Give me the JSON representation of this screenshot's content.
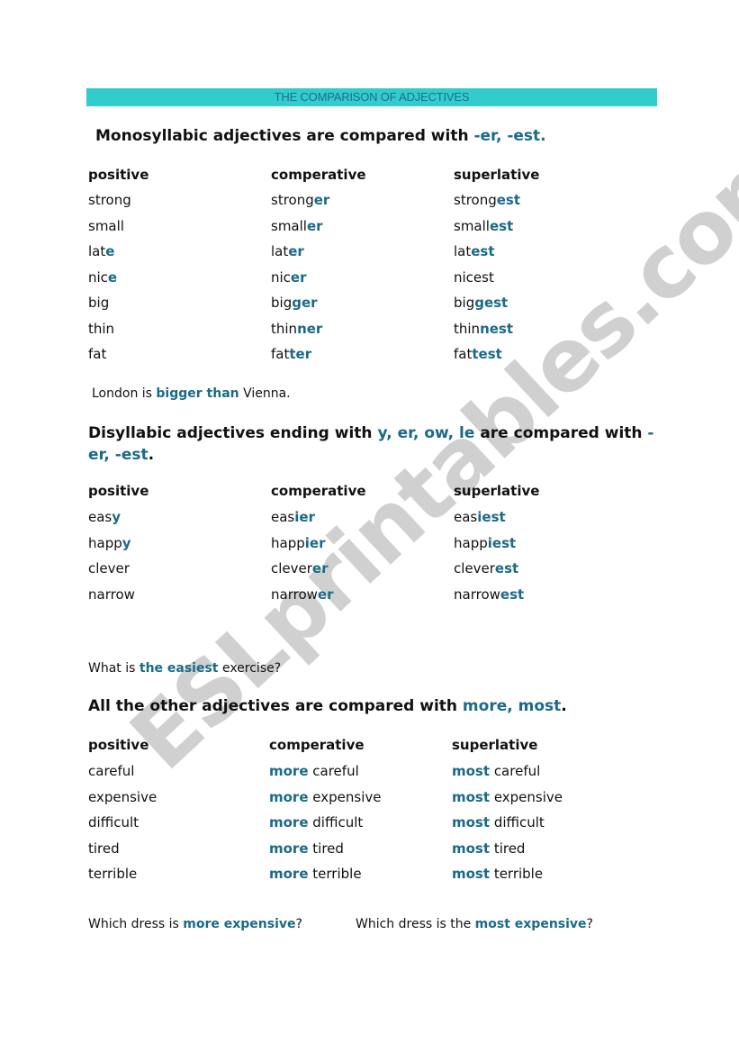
{
  "title": "THE COMPARISON OF ADJECTIVES",
  "colors": {
    "title_bar": "#33cccc",
    "accent": "#1b6a86",
    "watermark": "#999999"
  },
  "watermark": "ESLprintables.com",
  "columns": {
    "positive": "positive",
    "comparative": "comperative",
    "superlative": "superlative"
  },
  "section1": {
    "heading_text": "Monosyllabic adjectives are compared with ",
    "heading_accent": "-er, -est.",
    "rows": [
      {
        "pos": [
          "strong",
          ""
        ],
        "comp": [
          "strong",
          "er"
        ],
        "sup": [
          "strong",
          "est"
        ]
      },
      {
        "pos": [
          "small",
          ""
        ],
        "comp": [
          "small",
          "er"
        ],
        "sup": [
          "small",
          "est"
        ]
      },
      {
        "pos": [
          "lat",
          "e"
        ],
        "comp": [
          "lat",
          "er"
        ],
        "sup": [
          "lat",
          "est"
        ]
      },
      {
        "pos": [
          "nic",
          "e"
        ],
        "comp": [
          "nic",
          "er"
        ],
        "sup": [
          "nicest",
          ""
        ]
      },
      {
        "pos": [
          "big",
          ""
        ],
        "comp": [
          "big",
          "ger"
        ],
        "sup": [
          "big",
          "gest"
        ]
      },
      {
        "pos": [
          "thin",
          ""
        ],
        "comp": [
          "thin",
          "ner"
        ],
        "sup": [
          "thin",
          "nest"
        ]
      },
      {
        "pos": [
          "fat",
          ""
        ],
        "comp": [
          "fat",
          "ter"
        ],
        "sup": [
          "fat",
          "test"
        ]
      }
    ],
    "example": {
      "a": "London is ",
      "b": "bigger than",
      "c": " Vienna."
    }
  },
  "section2": {
    "heading_text": "Disyllabic adjectives ending with ",
    "heading_accent1": "y, er, ow, le",
    "heading_text2": " are compared with ",
    "heading_accent2": "-",
    "heading_accent3": "er, -est",
    "heading_end": ".",
    "rows": [
      {
        "pos": [
          "eas",
          "y"
        ],
        "comp": [
          "eas",
          "ier"
        ],
        "sup": [
          "eas",
          "iest"
        ]
      },
      {
        "pos": [
          "happ",
          "y"
        ],
        "comp": [
          "happ",
          "ier"
        ],
        "sup": [
          "happ",
          "iest"
        ]
      },
      {
        "pos": [
          "clever",
          ""
        ],
        "comp": [
          "clever",
          "er"
        ],
        "sup": [
          "clever",
          "est"
        ]
      },
      {
        "pos": [
          "narrow",
          ""
        ],
        "comp": [
          "narrow",
          "er"
        ],
        "sup": [
          "narrow",
          "est"
        ]
      }
    ],
    "example": {
      "a": "What is ",
      "b": "the easiest",
      "c": " exercise?"
    }
  },
  "section3": {
    "heading_text": "All the other adjectives are compared with ",
    "heading_accent": "more, most",
    "heading_end": ".",
    "rows": [
      {
        "pos": "careful",
        "comp": [
          "more",
          " careful"
        ],
        "sup": [
          "most",
          " careful"
        ]
      },
      {
        "pos": "expensive",
        "comp": [
          "more",
          " expensive"
        ],
        "sup": [
          "most",
          " expensive"
        ]
      },
      {
        "pos": "difficult",
        "comp": [
          "more",
          " difficult"
        ],
        "sup": [
          "most",
          " difficult"
        ]
      },
      {
        "pos": "tired",
        "comp": [
          "more",
          " tired"
        ],
        "sup": [
          "most",
          " tired"
        ]
      },
      {
        "pos": "terrible",
        "comp": [
          "more",
          " terrible"
        ],
        "sup": [
          "most",
          " terrible"
        ]
      }
    ],
    "example1": {
      "a": "Which dress is ",
      "b": "more expensive",
      "c": "?"
    },
    "example2": {
      "a": "Which dress is the ",
      "b": "most expensive",
      "c": "?"
    }
  }
}
